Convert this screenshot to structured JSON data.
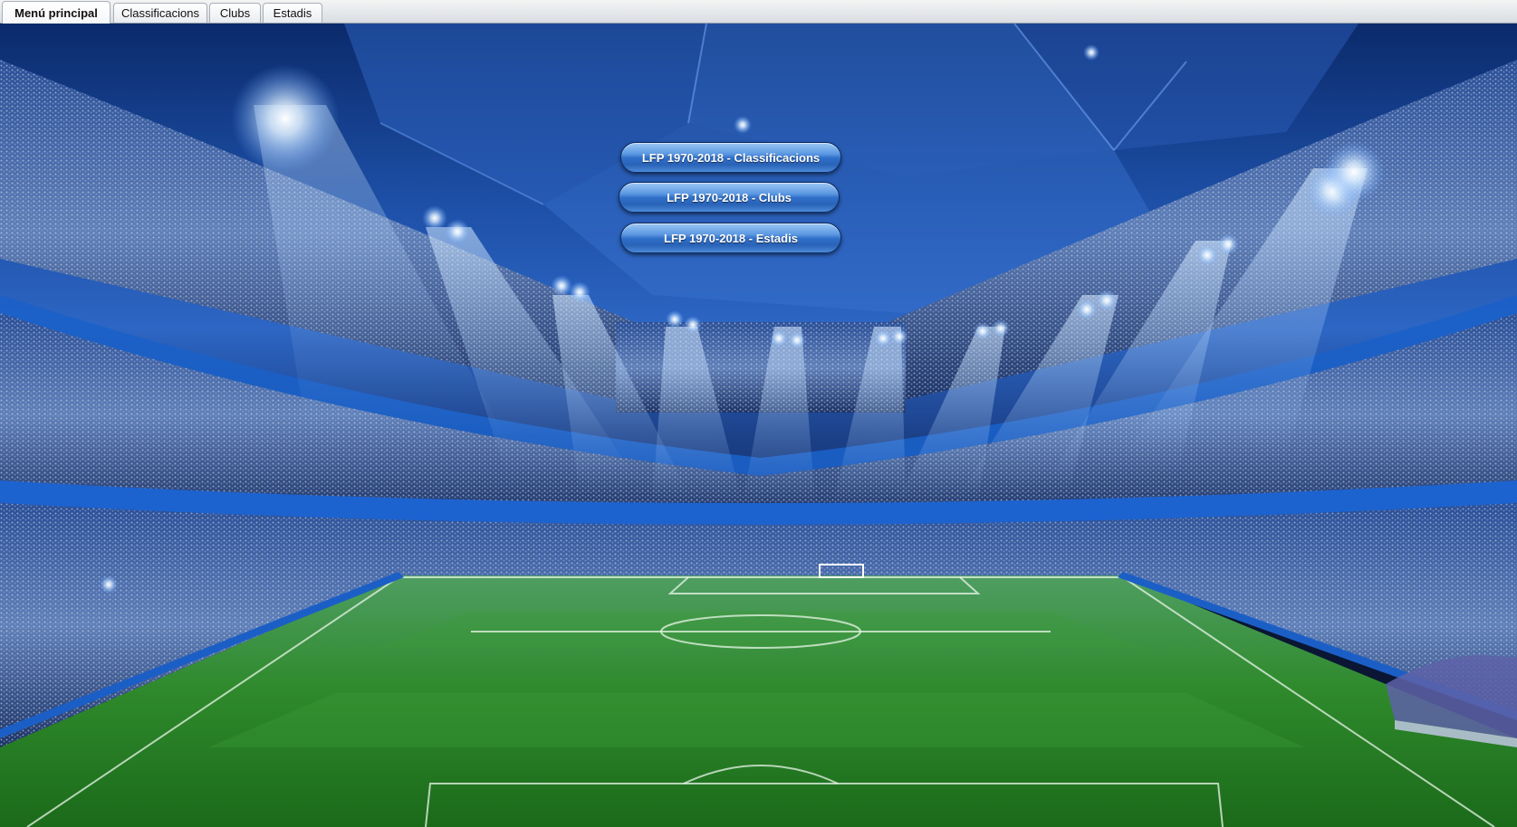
{
  "tabs": [
    {
      "label": "Menú principal",
      "active": true
    },
    {
      "label": "Classificacions",
      "active": false
    },
    {
      "label": "Clubs",
      "active": false
    },
    {
      "label": "Estadis",
      "active": false
    }
  ],
  "menu": {
    "buttons": [
      {
        "label": "LFP 1970-2018 - Classificacions"
      },
      {
        "label": "LFP 1970-2018 - Clubs"
      },
      {
        "label": "LFP 1970-2018 - Estadis"
      }
    ]
  },
  "colors": {
    "pitch": "#2f8a2c",
    "sky": "#1d4fa6",
    "button": "#2f6fc9"
  }
}
